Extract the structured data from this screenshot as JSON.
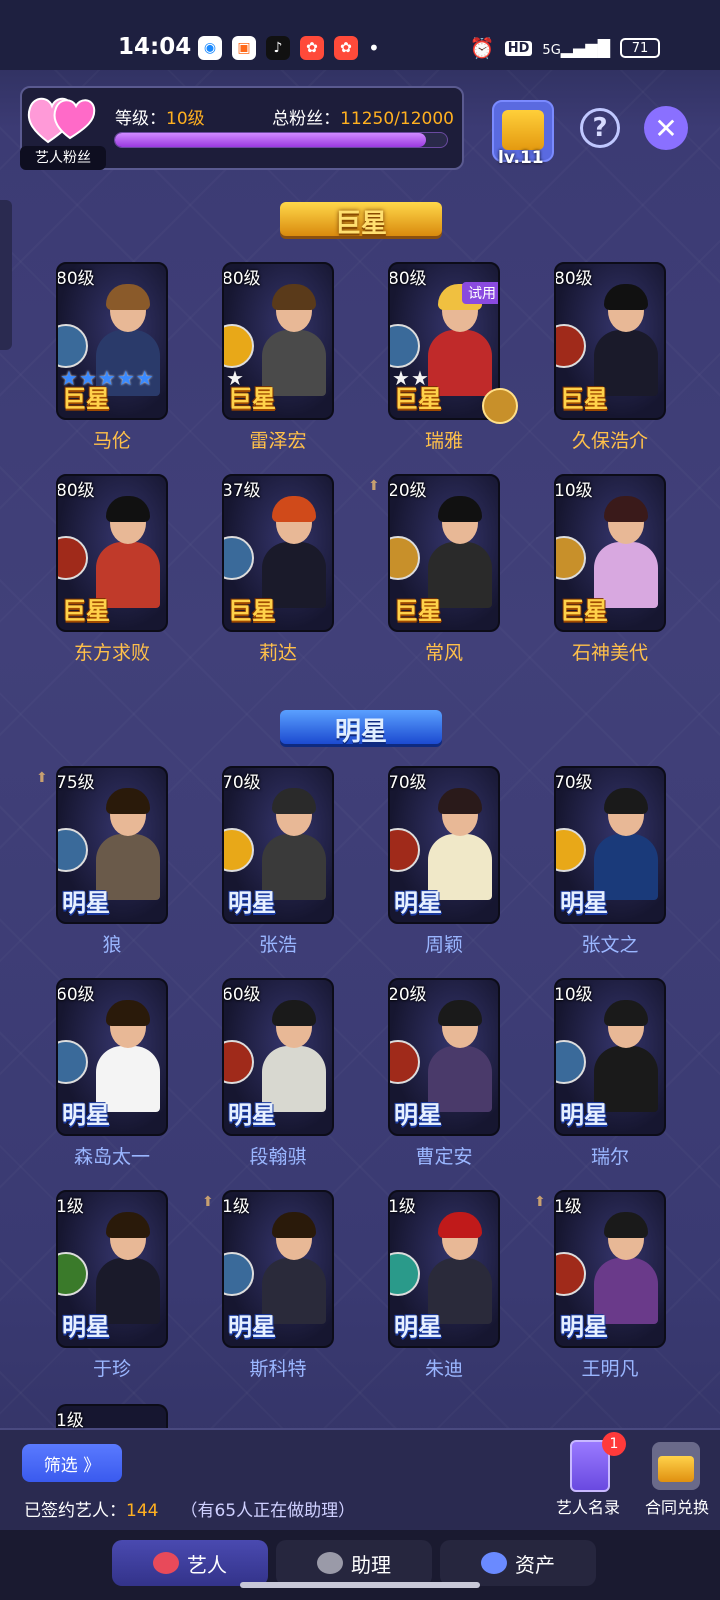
{
  "status_bar": {
    "time": "14:04",
    "apps": [
      "bubble-icon",
      "game-controller-icon",
      "tiktok-icon",
      "app-red-icon",
      "app-red2-icon"
    ],
    "dot": "•",
    "hd": "HD",
    "signal": "5G",
    "battery": "71"
  },
  "header": {
    "fan_label": "艺人粉丝",
    "level_label": "等级：",
    "level_value": "10级",
    "fans_label": "总粉丝：",
    "fans_value": "11250/12000",
    "fans_progress": 0.9375,
    "studio_level": "lv.11",
    "help": "?",
    "close": "✕"
  },
  "sections": {
    "superstar": "巨星",
    "star": "明星"
  },
  "superstars": [
    {
      "level": "80级",
      "rank": "巨星",
      "name": "马伦",
      "stars": [
        1,
        1,
        1,
        1,
        1
      ],
      "type_color": "#3a6a9a",
      "hair": "#8a5a2a",
      "body": "#2a3a6a",
      "upgrade": false,
      "trial": false
    },
    {
      "level": "80级",
      "rank": "巨星",
      "name": "雷泽宏",
      "stars": [
        2
      ],
      "type_color": "#e8a818",
      "hair": "#5a3a1a",
      "body": "#4a4a4a",
      "upgrade": false,
      "trial": false
    },
    {
      "level": "80级",
      "rank": "巨星",
      "name": "瑞雅",
      "stars": [
        2,
        2
      ],
      "type_color": "#3a6a9a",
      "hair": "#f0c040",
      "body": "#c02a2a",
      "upgrade": false,
      "trial": true,
      "trial_label": "试用"
    },
    {
      "level": "80级",
      "rank": "巨星",
      "name": "久保浩介",
      "stars": [],
      "type_color": "#a02a1a",
      "hair": "#111111",
      "body": "#1a1a2a",
      "upgrade": false,
      "trial": false
    },
    {
      "level": "80级",
      "rank": "巨星",
      "name": "东方求败",
      "stars": [],
      "type_color": "#a02a1a",
      "hair": "#111111",
      "body": "#c03a2a",
      "upgrade": false,
      "trial": false
    },
    {
      "level": "37级",
      "rank": "巨星",
      "name": "莉达",
      "stars": [],
      "type_color": "#3a6a9a",
      "hair": "#d04a1a",
      "body": "#1a1a2a",
      "upgrade": false,
      "trial": false
    },
    {
      "level": "20级",
      "rank": "巨星",
      "name": "常风",
      "stars": [],
      "type_color": "#c8902a",
      "hair": "#111111",
      "body": "#2a2a2a",
      "upgrade": true,
      "trial": false
    },
    {
      "level": "10级",
      "rank": "巨星",
      "name": "石神美代",
      "stars": [],
      "type_color": "#c8902a",
      "hair": "#3a1a1a",
      "body": "#d8a8e0",
      "upgrade": false,
      "trial": false
    }
  ],
  "stars": [
    {
      "level": "75级",
      "rank": "明星",
      "name": "狼",
      "type_color": "#3a6a9a",
      "hair": "#2a1a0a",
      "body": "#6a5a4a",
      "upgrade": true
    },
    {
      "level": "70级",
      "rank": "明星",
      "name": "张浩",
      "type_color": "#e8a818",
      "hair": "#2a2a2a",
      "body": "#3a3a3a",
      "upgrade": false
    },
    {
      "level": "70级",
      "rank": "明星",
      "name": "周颖",
      "type_color": "#a02a1a",
      "hair": "#2a1a1a",
      "body": "#f0e8c8",
      "upgrade": false
    },
    {
      "level": "70级",
      "rank": "明星",
      "name": "张文之",
      "type_color": "#e8a818",
      "hair": "#1a1a1a",
      "body": "#1a3a7a",
      "upgrade": false
    },
    {
      "level": "60级",
      "rank": "明星",
      "name": "森岛太一",
      "type_color": "#3a6a9a",
      "hair": "#2a1a0a",
      "body": "#f4f4f4",
      "upgrade": false
    },
    {
      "level": "60级",
      "rank": "明星",
      "name": "段翰骐",
      "type_color": "#a02a1a",
      "hair": "#1a1a1a",
      "body": "#d8d8d0",
      "upgrade": false
    },
    {
      "level": "20级",
      "rank": "明星",
      "name": "曹定安",
      "type_color": "#a02a1a",
      "hair": "#1a1a1a",
      "body": "#4a3a6a",
      "upgrade": false
    },
    {
      "level": "10级",
      "rank": "明星",
      "name": "瑞尔",
      "type_color": "#3a6a9a",
      "hair": "#1a1a1a",
      "body": "#1a1a1a",
      "upgrade": false
    },
    {
      "level": "1级",
      "rank": "明星",
      "name": "于珍",
      "type_color": "#3a7a2a",
      "hair": "#2a1a0a",
      "body": "#1a1a2a",
      "upgrade": false
    },
    {
      "level": "1级",
      "rank": "明星",
      "name": "斯科特",
      "type_color": "#3a6a9a",
      "hair": "#2a1a0a",
      "body": "#2a2a3a",
      "upgrade": true
    },
    {
      "level": "1级",
      "rank": "明星",
      "name": "朱迪",
      "type_color": "#2a9a8a",
      "hair": "#c01a1a",
      "body": "#2a2a3a",
      "upgrade": false
    },
    {
      "level": "1级",
      "rank": "明星",
      "name": "王明凡",
      "type_color": "#a02a1a",
      "hair": "#1a1a1a",
      "body": "#6a3a8a",
      "upgrade": true
    }
  ],
  "partial_card": {
    "level": "1级"
  },
  "footer": {
    "filter": "筛选 》",
    "signed_label": "已签约艺人：",
    "signed_count": "144",
    "assistant_note": "（有65人正在做助理）",
    "roster_label": "艺人名录",
    "roster_badge": "1",
    "contract_label": "合同兑换"
  },
  "tabs": [
    {
      "label": "艺人",
      "active": true
    },
    {
      "label": "助理",
      "active": false
    },
    {
      "label": "资产",
      "active": false
    }
  ]
}
